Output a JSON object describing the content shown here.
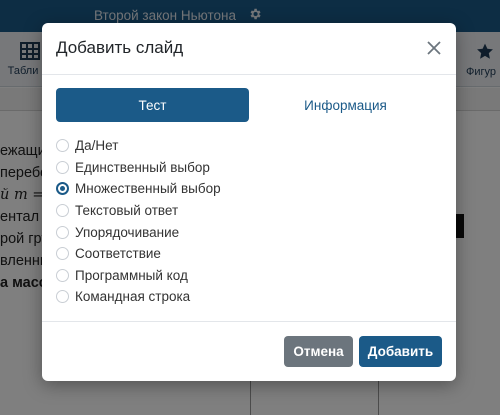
{
  "app": {
    "document_title": "Второй закон Ньютона",
    "toolbar": {
      "left_label": "Табли",
      "right_label": "Фигур"
    },
    "background_lines": [
      "ежащи",
      "перебе",
      "й m =",
      "ентал",
      "рой гру",
      "вленны",
      "а масс"
    ]
  },
  "dialog": {
    "title": "Добавить слайд",
    "tabs": [
      {
        "label": "Тест",
        "active": true
      },
      {
        "label": "Информация",
        "active": false
      }
    ],
    "options": [
      {
        "label": "Да/Нет",
        "checked": false
      },
      {
        "label": "Единственный выбор",
        "checked": false
      },
      {
        "label": "Множественный выбор",
        "checked": true
      },
      {
        "label": "Текстовый ответ",
        "checked": false
      },
      {
        "label": "Упорядочивание",
        "checked": false
      },
      {
        "label": "Соответствие",
        "checked": false
      },
      {
        "label": "Программный код",
        "checked": false
      },
      {
        "label": "Командная строка",
        "checked": false
      }
    ],
    "cancel_label": "Отмена",
    "add_label": "Добавить"
  },
  "colors": {
    "primary": "#1b5a88",
    "secondary": "#6c757d",
    "overlay": "rgba(0,0,0,0.5)"
  }
}
